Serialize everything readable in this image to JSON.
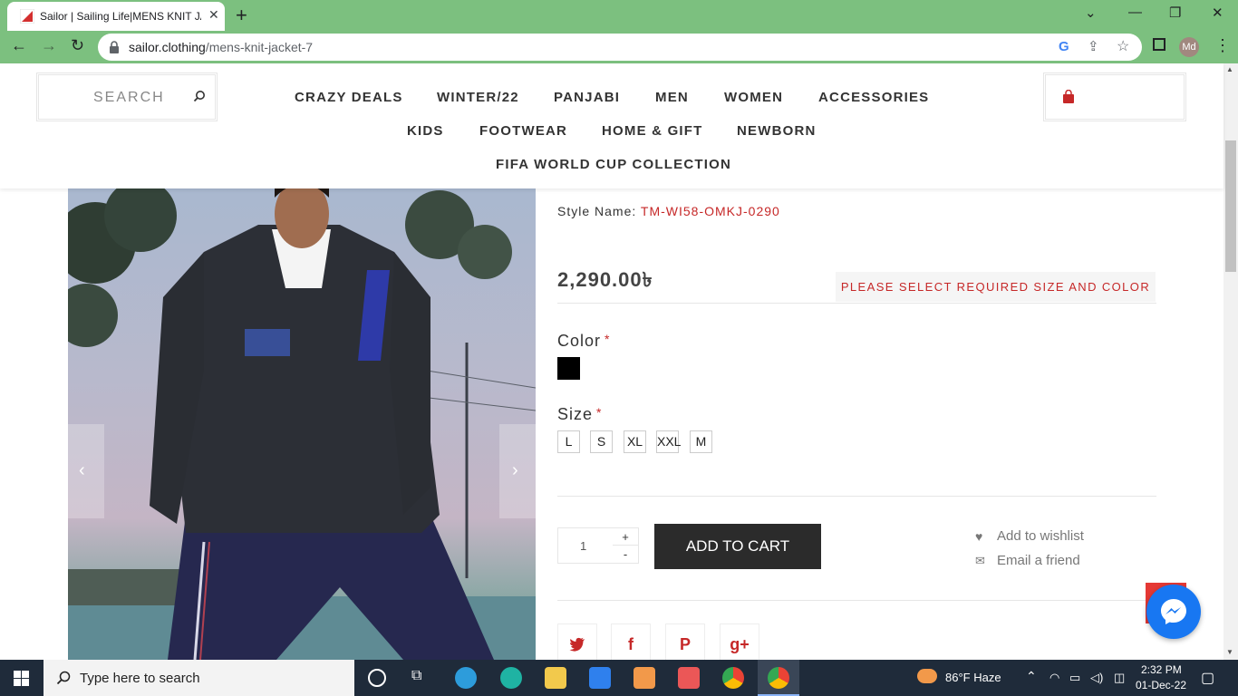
{
  "browser": {
    "tab_title": "Sailor | Sailing Life|MENS KNIT JACKET",
    "url_domain": "sailor.clothing",
    "url_path": "/mens-knit-jacket-7",
    "profile_initials": "Md",
    "accent": "#7cc07f"
  },
  "header": {
    "search_placeholder": "SEARCH",
    "nav_row1": [
      "CRAZY DEALS",
      "WINTER/22",
      "PANJABI",
      "MEN",
      "WOMEN",
      "ACCESSORIES"
    ],
    "nav_row2": [
      "KIDS",
      "FOOTWEAR",
      "HOME & GIFT",
      "NEWBORN"
    ],
    "nav_row3": [
      "FIFA WORLD CUP COLLECTION"
    ]
  },
  "product": {
    "style_label": "Style Name:",
    "style_value": "TM-WI58-OMKJ-0290",
    "price": "2,290.00৳",
    "warning": "PLEASE SELECT REQUIRED SIZE AND COLOR",
    "color_label": "Color",
    "size_label": "Size",
    "required_mark": "*",
    "color_swatch": "#000000",
    "sizes": [
      "L",
      "S",
      "XL",
      "XXL",
      "M"
    ],
    "quantity": "1",
    "qty_plus": "+",
    "qty_minus": "-",
    "add_to_cart": "ADD TO CART",
    "wishlist": "Add to wishlist",
    "email_friend": "Email a friend",
    "social": [
      "twitter-icon",
      "facebook-icon",
      "pinterest-icon",
      "google-plus-icon"
    ],
    "brand_red": "#c62828"
  },
  "taskbar": {
    "search_text": "Type here to search",
    "weather": "86°F  Haze",
    "time": "2:32 PM",
    "date": "01-Dec-22"
  }
}
